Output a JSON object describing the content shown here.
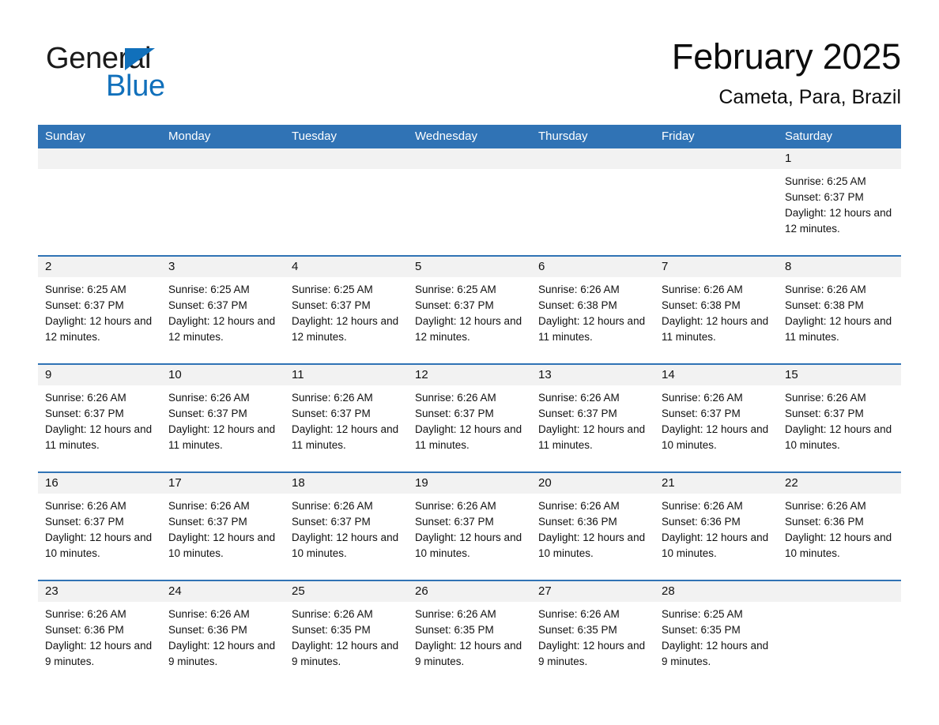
{
  "brand": {
    "name_part1": "General",
    "name_part2": "Blue",
    "triangle_color": "#1170bb"
  },
  "header": {
    "title": "February 2025",
    "subtitle": "Cameta, Para, Brazil"
  },
  "theme": {
    "header_blue": "#3073b5",
    "date_band_gray": "#f2f2f2",
    "text_black": "#111111"
  },
  "weekdays": [
    "Sunday",
    "Monday",
    "Tuesday",
    "Wednesday",
    "Thursday",
    "Friday",
    "Saturday"
  ],
  "weeks": [
    [
      {
        "date": "",
        "sunrise": "",
        "sunset": "",
        "daylight": ""
      },
      {
        "date": "",
        "sunrise": "",
        "sunset": "",
        "daylight": ""
      },
      {
        "date": "",
        "sunrise": "",
        "sunset": "",
        "daylight": ""
      },
      {
        "date": "",
        "sunrise": "",
        "sunset": "",
        "daylight": ""
      },
      {
        "date": "",
        "sunrise": "",
        "sunset": "",
        "daylight": ""
      },
      {
        "date": "",
        "sunrise": "",
        "sunset": "",
        "daylight": ""
      },
      {
        "date": "1",
        "sunrise": "Sunrise: 6:25 AM",
        "sunset": "Sunset: 6:37 PM",
        "daylight": "Daylight: 12 hours and 12 minutes."
      }
    ],
    [
      {
        "date": "2",
        "sunrise": "Sunrise: 6:25 AM",
        "sunset": "Sunset: 6:37 PM",
        "daylight": "Daylight: 12 hours and 12 minutes."
      },
      {
        "date": "3",
        "sunrise": "Sunrise: 6:25 AM",
        "sunset": "Sunset: 6:37 PM",
        "daylight": "Daylight: 12 hours and 12 minutes."
      },
      {
        "date": "4",
        "sunrise": "Sunrise: 6:25 AM",
        "sunset": "Sunset: 6:37 PM",
        "daylight": "Daylight: 12 hours and 12 minutes."
      },
      {
        "date": "5",
        "sunrise": "Sunrise: 6:25 AM",
        "sunset": "Sunset: 6:37 PM",
        "daylight": "Daylight: 12 hours and 12 minutes."
      },
      {
        "date": "6",
        "sunrise": "Sunrise: 6:26 AM",
        "sunset": "Sunset: 6:38 PM",
        "daylight": "Daylight: 12 hours and 11 minutes."
      },
      {
        "date": "7",
        "sunrise": "Sunrise: 6:26 AM",
        "sunset": "Sunset: 6:38 PM",
        "daylight": "Daylight: 12 hours and 11 minutes."
      },
      {
        "date": "8",
        "sunrise": "Sunrise: 6:26 AM",
        "sunset": "Sunset: 6:38 PM",
        "daylight": "Daylight: 12 hours and 11 minutes."
      }
    ],
    [
      {
        "date": "9",
        "sunrise": "Sunrise: 6:26 AM",
        "sunset": "Sunset: 6:37 PM",
        "daylight": "Daylight: 12 hours and 11 minutes."
      },
      {
        "date": "10",
        "sunrise": "Sunrise: 6:26 AM",
        "sunset": "Sunset: 6:37 PM",
        "daylight": "Daylight: 12 hours and 11 minutes."
      },
      {
        "date": "11",
        "sunrise": "Sunrise: 6:26 AM",
        "sunset": "Sunset: 6:37 PM",
        "daylight": "Daylight: 12 hours and 11 minutes."
      },
      {
        "date": "12",
        "sunrise": "Sunrise: 6:26 AM",
        "sunset": "Sunset: 6:37 PM",
        "daylight": "Daylight: 12 hours and 11 minutes."
      },
      {
        "date": "13",
        "sunrise": "Sunrise: 6:26 AM",
        "sunset": "Sunset: 6:37 PM",
        "daylight": "Daylight: 12 hours and 11 minutes."
      },
      {
        "date": "14",
        "sunrise": "Sunrise: 6:26 AM",
        "sunset": "Sunset: 6:37 PM",
        "daylight": "Daylight: 12 hours and 10 minutes."
      },
      {
        "date": "15",
        "sunrise": "Sunrise: 6:26 AM",
        "sunset": "Sunset: 6:37 PM",
        "daylight": "Daylight: 12 hours and 10 minutes."
      }
    ],
    [
      {
        "date": "16",
        "sunrise": "Sunrise: 6:26 AM",
        "sunset": "Sunset: 6:37 PM",
        "daylight": "Daylight: 12 hours and 10 minutes."
      },
      {
        "date": "17",
        "sunrise": "Sunrise: 6:26 AM",
        "sunset": "Sunset: 6:37 PM",
        "daylight": "Daylight: 12 hours and 10 minutes."
      },
      {
        "date": "18",
        "sunrise": "Sunrise: 6:26 AM",
        "sunset": "Sunset: 6:37 PM",
        "daylight": "Daylight: 12 hours and 10 minutes."
      },
      {
        "date": "19",
        "sunrise": "Sunrise: 6:26 AM",
        "sunset": "Sunset: 6:37 PM",
        "daylight": "Daylight: 12 hours and 10 minutes."
      },
      {
        "date": "20",
        "sunrise": "Sunrise: 6:26 AM",
        "sunset": "Sunset: 6:36 PM",
        "daylight": "Daylight: 12 hours and 10 minutes."
      },
      {
        "date": "21",
        "sunrise": "Sunrise: 6:26 AM",
        "sunset": "Sunset: 6:36 PM",
        "daylight": "Daylight: 12 hours and 10 minutes."
      },
      {
        "date": "22",
        "sunrise": "Sunrise: 6:26 AM",
        "sunset": "Sunset: 6:36 PM",
        "daylight": "Daylight: 12 hours and 10 minutes."
      }
    ],
    [
      {
        "date": "23",
        "sunrise": "Sunrise: 6:26 AM",
        "sunset": "Sunset: 6:36 PM",
        "daylight": "Daylight: 12 hours and 9 minutes."
      },
      {
        "date": "24",
        "sunrise": "Sunrise: 6:26 AM",
        "sunset": "Sunset: 6:36 PM",
        "daylight": "Daylight: 12 hours and 9 minutes."
      },
      {
        "date": "25",
        "sunrise": "Sunrise: 6:26 AM",
        "sunset": "Sunset: 6:35 PM",
        "daylight": "Daylight: 12 hours and 9 minutes."
      },
      {
        "date": "26",
        "sunrise": "Sunrise: 6:26 AM",
        "sunset": "Sunset: 6:35 PM",
        "daylight": "Daylight: 12 hours and 9 minutes."
      },
      {
        "date": "27",
        "sunrise": "Sunrise: 6:26 AM",
        "sunset": "Sunset: 6:35 PM",
        "daylight": "Daylight: 12 hours and 9 minutes."
      },
      {
        "date": "28",
        "sunrise": "Sunrise: 6:25 AM",
        "sunset": "Sunset: 6:35 PM",
        "daylight": "Daylight: 12 hours and 9 minutes."
      },
      {
        "date": "",
        "sunrise": "",
        "sunset": "",
        "daylight": ""
      }
    ]
  ]
}
